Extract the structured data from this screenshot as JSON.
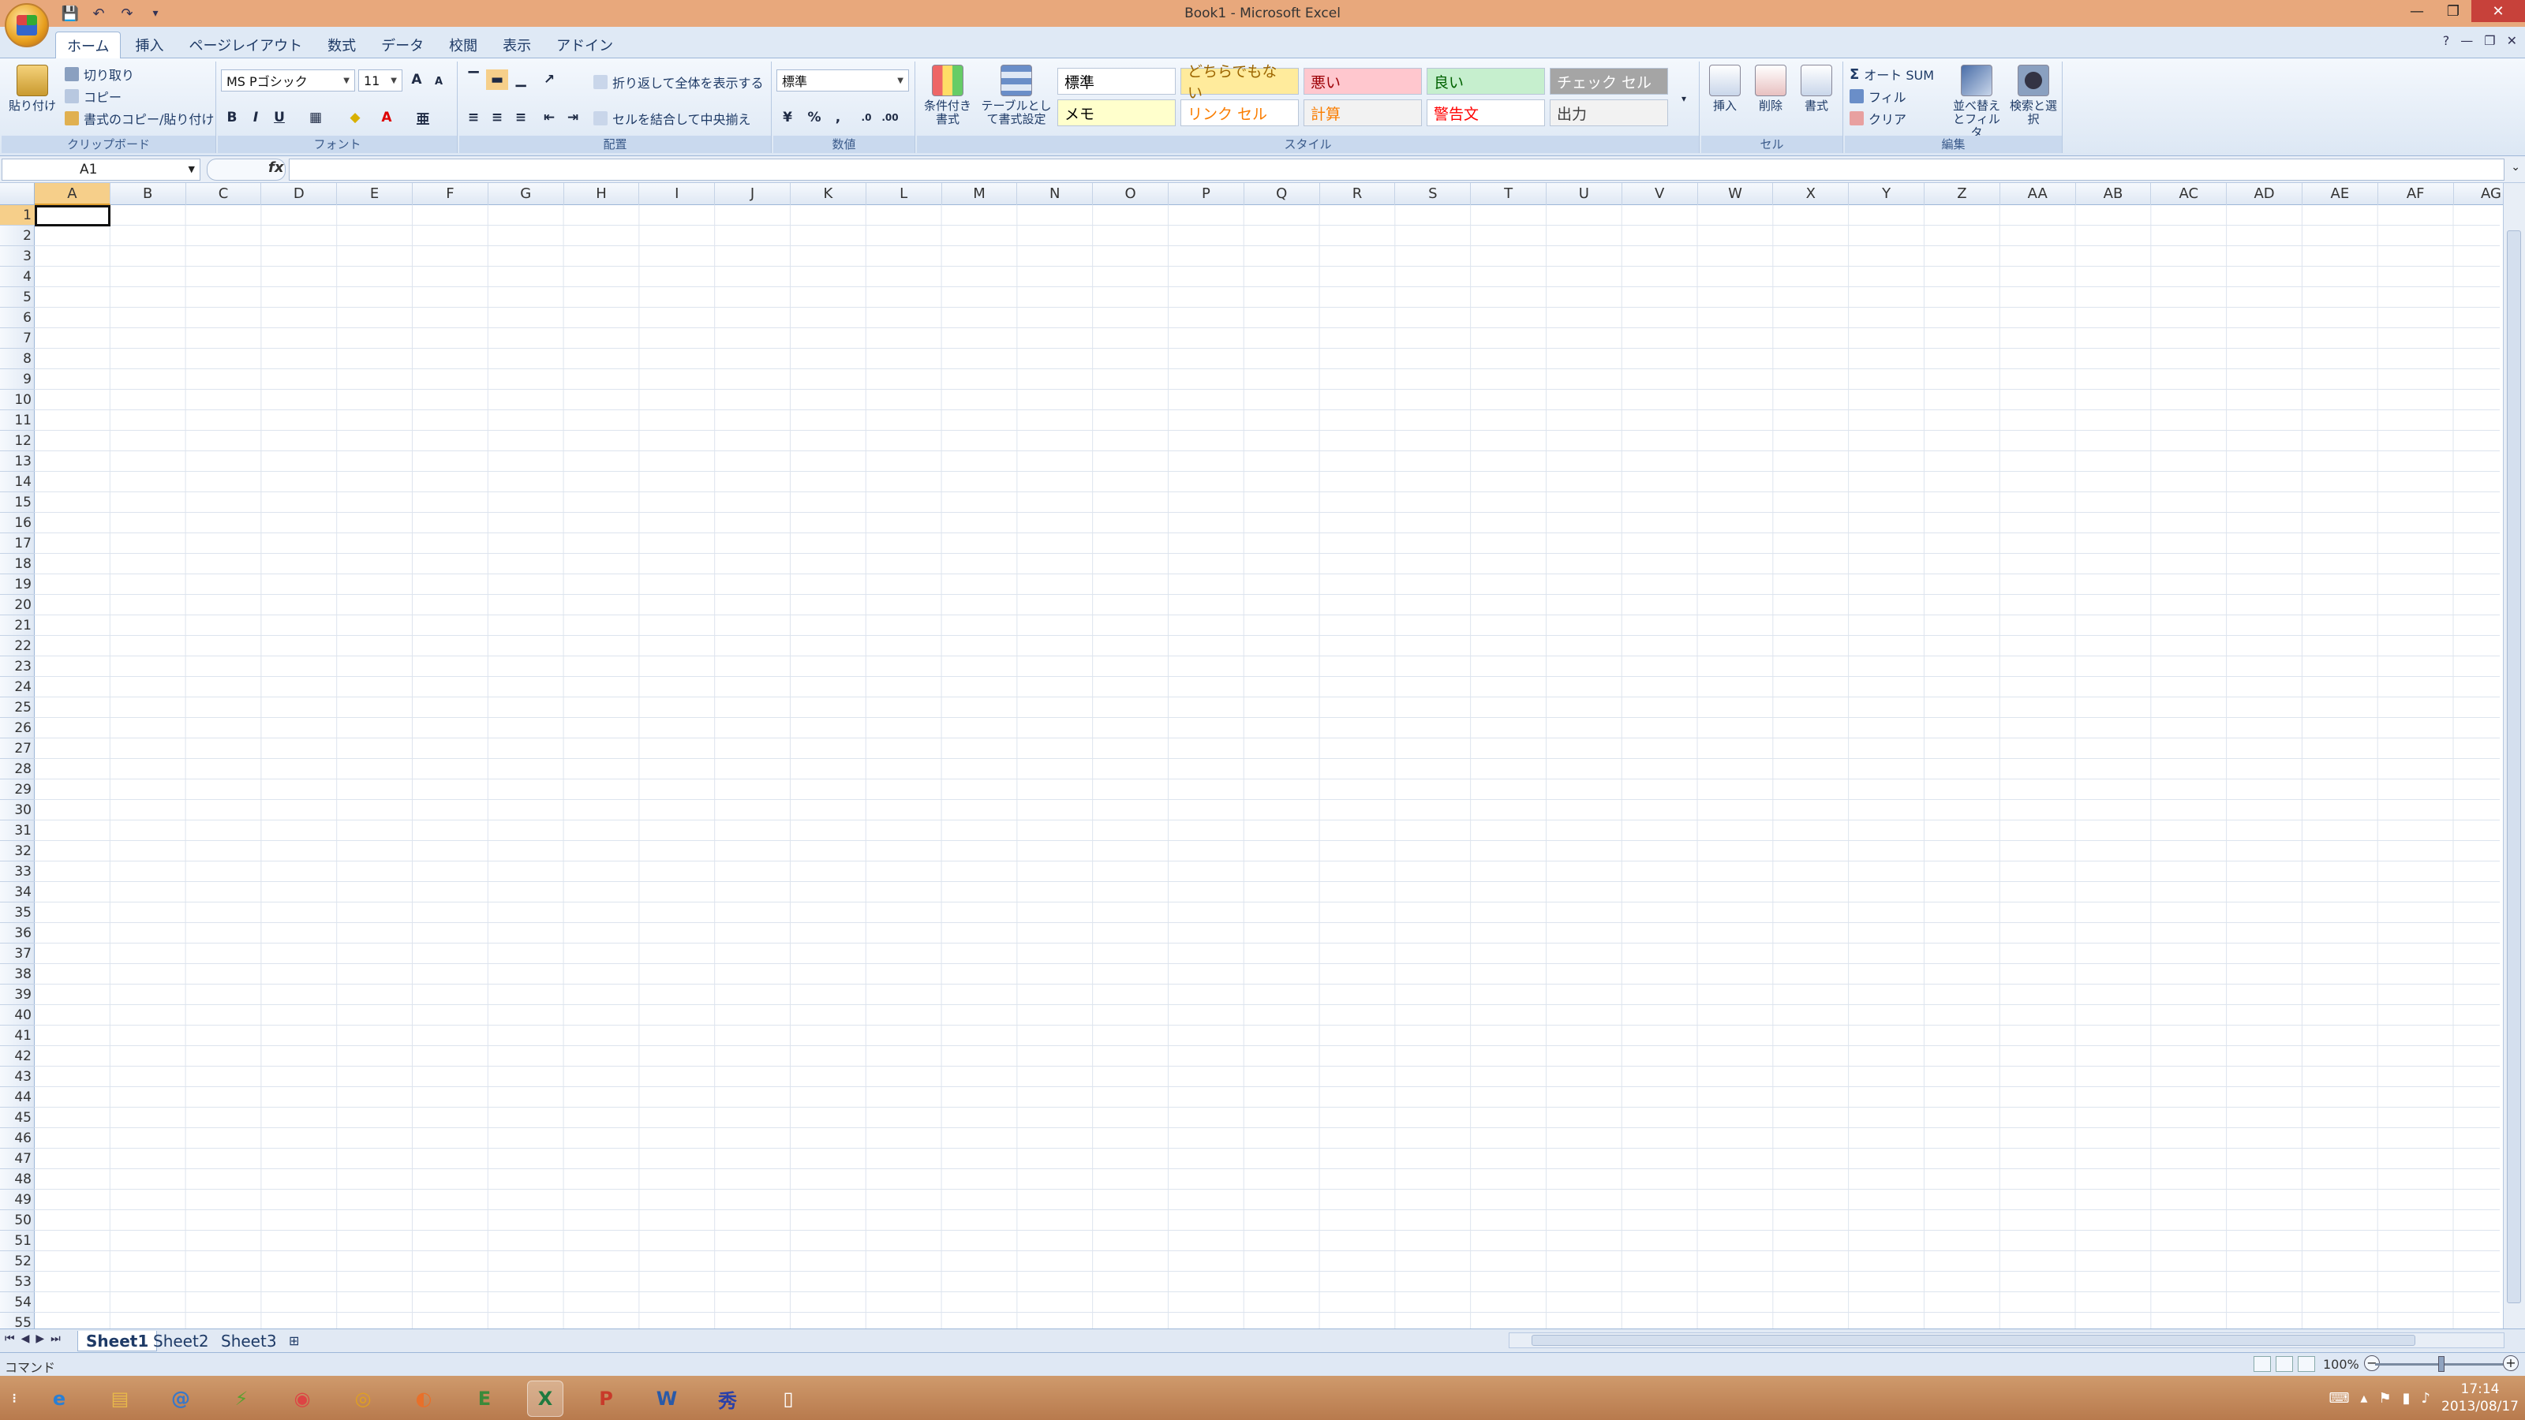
{
  "window": {
    "title": "Book1 - Microsoft Excel"
  },
  "qat": {
    "save_icon": "save-icon",
    "undo_icon": "undo-icon",
    "redo_icon": "redo-icon",
    "customize_icon": "dropdown-icon"
  },
  "tabs": [
    "ホーム",
    "挿入",
    "ページレイアウト",
    "数式",
    "データ",
    "校閲",
    "表示",
    "アドイン"
  ],
  "ribbon": {
    "clipboard": {
      "label": "クリップボード",
      "paste": "貼り付け",
      "cut": "切り取り",
      "copy": "コピー",
      "format_painter": "書式のコピー/貼り付け"
    },
    "font": {
      "label": "フォント",
      "font_name": "MS Pゴシック",
      "font_size": "11"
    },
    "alignment": {
      "label": "配置",
      "wrap": "折り返して全体を表示する",
      "merge": "セルを結合して中央揃え"
    },
    "number": {
      "label": "数値",
      "format": "標準"
    },
    "styles": {
      "label": "スタイル",
      "conditional": "条件付き書式",
      "table": "テーブルとして書式設定",
      "cells": [
        {
          "label": "標準",
          "bg": "#ffffff",
          "color": "#000000"
        },
        {
          "label": "どちらでもない",
          "bg": "#ffeb9c",
          "color": "#9c6500"
        },
        {
          "label": "悪い",
          "bg": "#ffc7ce",
          "color": "#9c0006"
        },
        {
          "label": "良い",
          "bg": "#c6efce",
          "color": "#006100"
        },
        {
          "label": "チェック セル",
          "bg": "#a5a5a5",
          "color": "#ffffff"
        },
        {
          "label": "メモ",
          "bg": "#ffffcc",
          "color": "#000000"
        },
        {
          "label": "リンク セル",
          "bg": "#ffffff",
          "color": "#fa7d00"
        },
        {
          "label": "計算",
          "bg": "#f2f2f2",
          "color": "#fa7d00"
        },
        {
          "label": "警告文",
          "bg": "#ffffff",
          "color": "#ff0000"
        },
        {
          "label": "出力",
          "bg": "#f2f2f2",
          "color": "#3f3f3f"
        }
      ]
    },
    "cells": {
      "label": "セル",
      "insert": "挿入",
      "delete": "削除",
      "format": "書式"
    },
    "editing": {
      "label": "編集",
      "autosum": "オート SUM",
      "fill": "フィル",
      "clear": "クリア",
      "sort": "並べ替えとフィルタ",
      "find": "検索と選択"
    }
  },
  "formula_bar": {
    "name_box": "A1",
    "fx": "fx",
    "value": ""
  },
  "columns": [
    "A",
    "B",
    "C",
    "D",
    "E",
    "F",
    "G",
    "H",
    "I",
    "J",
    "K",
    "L",
    "M",
    "N",
    "O",
    "P",
    "Q",
    "R",
    "S",
    "T",
    "U",
    "V",
    "W",
    "X",
    "Y",
    "Z",
    "AA",
    "AB",
    "AC",
    "AD",
    "AE",
    "AF",
    "AG"
  ],
  "rows": [
    "1",
    "2",
    "3",
    "4",
    "5",
    "6",
    "7",
    "8",
    "9",
    "10",
    "11",
    "12",
    "13",
    "14",
    "15",
    "16",
    "17",
    "18",
    "19",
    "20",
    "21",
    "22",
    "23",
    "24",
    "25",
    "26",
    "27",
    "28",
    "29",
    "30",
    "31",
    "32",
    "33",
    "34",
    "35",
    "36",
    "37",
    "38",
    "39",
    "40",
    "41",
    "42",
    "43",
    "44",
    "45",
    "46",
    "47",
    "48",
    "49",
    "50",
    "51",
    "52",
    "53",
    "54",
    "55"
  ],
  "sheets": [
    "Sheet1",
    "Sheet2",
    "Sheet3"
  ],
  "status": {
    "mode": "コマンド",
    "zoom": "100%"
  },
  "taskbar": {
    "apps": [
      "ie-icon",
      "explorer-icon",
      "mail-icon",
      "app-icon",
      "chrome-icon",
      "app2-icon",
      "firefox-icon",
      "evernote-icon",
      "excel-icon",
      "pdf-icon",
      "word-icon",
      "app3-icon",
      "notepad-icon"
    ],
    "time": "17:14",
    "date": "2013/08/17"
  }
}
